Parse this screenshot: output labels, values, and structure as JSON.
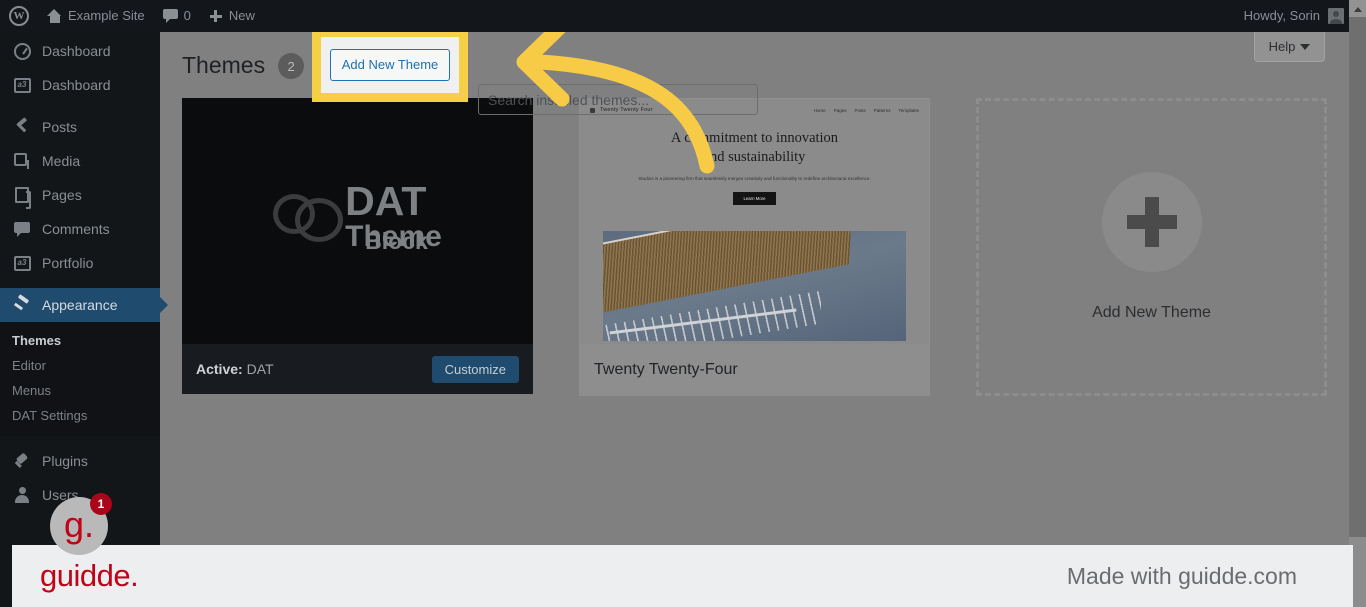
{
  "adminbar": {
    "wp_logo": "W",
    "site_name": "Example Site",
    "comment_count": "0",
    "new_label": "New",
    "howdy": "Howdy, Sorin"
  },
  "sidebar": {
    "items": [
      {
        "label": "Dashboard",
        "icon": "dashboard-icon"
      },
      {
        "label": "Dashboard",
        "icon": "a3-icon"
      },
      {
        "label": "Posts",
        "icon": "pin-icon"
      },
      {
        "label": "Media",
        "icon": "media-icon"
      },
      {
        "label": "Pages",
        "icon": "pages-icon"
      },
      {
        "label": "Comments",
        "icon": "comment-icon"
      },
      {
        "label": "Portfolio",
        "icon": "a3-icon"
      },
      {
        "label": "Appearance",
        "icon": "brush-icon"
      },
      {
        "label": "Plugins",
        "icon": "plug-icon"
      },
      {
        "label": "Users",
        "icon": "user-icon"
      }
    ],
    "submenu": [
      {
        "label": "Themes",
        "current": true
      },
      {
        "label": "Editor",
        "current": false
      },
      {
        "label": "Menus",
        "current": false
      },
      {
        "label": "DAT Settings",
        "current": false
      }
    ]
  },
  "header": {
    "title": "Themes",
    "count": "2",
    "add_new_label": "Add New Theme",
    "search_placeholder": "Search installed themes...",
    "search_value": "",
    "help_label": "Help"
  },
  "themes": {
    "active_card": {
      "logo_word1": "DAT",
      "logo_word2": "Theme",
      "logo_block": "Block",
      "active_prefix": "Active:",
      "active_name": "DAT",
      "customize_label": "Customize"
    },
    "tt4_card": {
      "brand": "Twenty Twenty Four",
      "nav": [
        "Home",
        "Pages",
        "Posts",
        "Patterns",
        "Templates"
      ],
      "heading_line1": "A commitment to innovation",
      "heading_line2": "and sustainability",
      "paragraph": "Studios is a pioneering firm that seamlessly merges creativity and functionality to redefine architectural excellence.",
      "cta_label": "Learn More",
      "name": "Twenty Twenty-Four"
    },
    "add_new_card": {
      "label": "Add New Theme",
      "icon": "plus-icon"
    }
  },
  "banner": {
    "logo": "guidde.",
    "made_with": "Made with guidde.com",
    "badge_letter": "g.",
    "badge_count": "1"
  },
  "colors": {
    "accent_yellow": "#f5d046",
    "wp_blue": "#2271b1",
    "guidde_red": "#c00418",
    "sidebar_bg": "#131619"
  }
}
